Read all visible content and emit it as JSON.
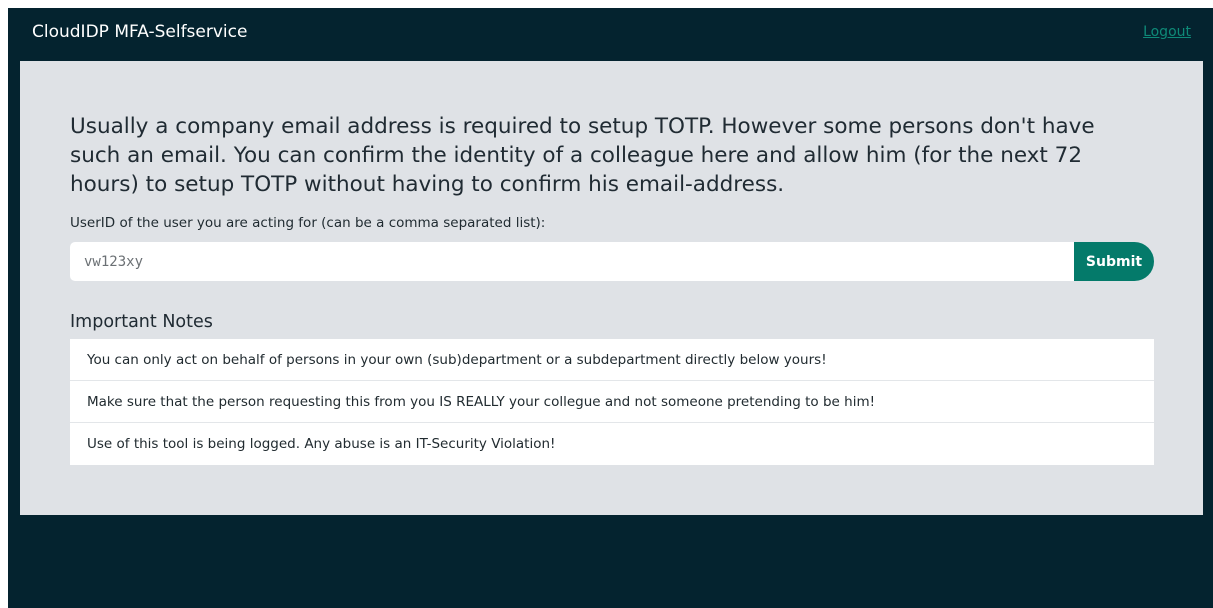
{
  "header": {
    "title": "CloudIDP MFA-Selfservice",
    "logout_label": "Logout"
  },
  "main": {
    "intro": "Usually a company email address is required to setup TOTP. However some persons don't have such an email. You can confirm the identity of a colleague here and allow him (for the next 72 hours) to setup TOTP without having to confirm his email-address.",
    "field_label": "UserID of the user you are acting for (can be a comma separated list):",
    "userid_placeholder": "vw123xy",
    "submit_label": "Submit",
    "notes_heading": "Important Notes",
    "notes": [
      "You can only act on behalf of persons in your own (sub)department or a subdepartment directly below yours!",
      "Make sure that the person requesting this from you IS REALLY your collegue and not someone pretending to be him!",
      "Use of this tool is being logged. Any abuse is an IT-Security Violation!"
    ]
  },
  "colors": {
    "background": "#04232f",
    "panel": "#dfe2e6",
    "accent": "#047a6a",
    "link": "#0e8a78"
  }
}
